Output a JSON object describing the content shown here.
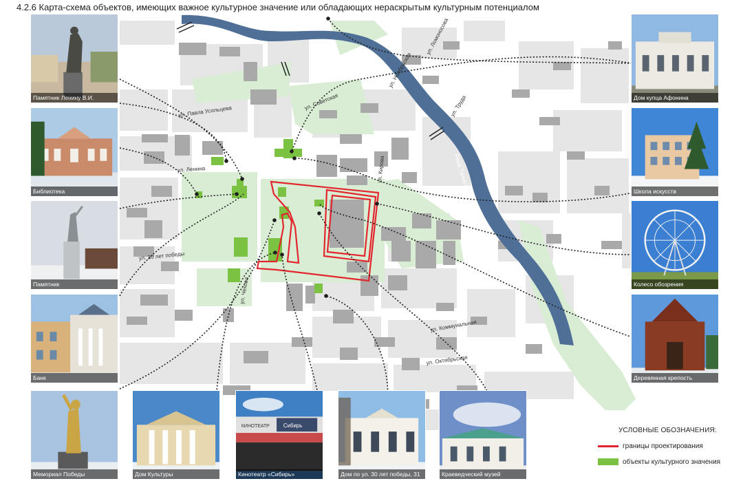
{
  "title": "4.2.6 Карта-схема объектов, имеющих важное культурное значение или обладающих нераскрытым культурным потенциалом",
  "colors": {
    "water": "#4f6f97",
    "park": "#d9ecd4",
    "culture": "#7cc242",
    "boundary": "#e3262d",
    "building": "#a9a9a9",
    "block": "#e6e6e6",
    "road": "#ffffff"
  },
  "streets": {
    "usoltseva": "ул. Павла Усольцева",
    "sovetskaya": "ул. Советская",
    "lenina": "ул. Ленина",
    "pobedy": "ул. 30 лет победы",
    "chekhova": "ул. Чехова",
    "lomonosova": "ул. Ломоносова",
    "noyabrskaya": "ул. Ноябрьская",
    "truda": "ул. Труда",
    "kirova": "ул. Кирова",
    "kommunalnaya": "ул. Коммунальная",
    "oktyabrskaya": "ул. Октябрьская",
    "river": "Река Тюкалка"
  },
  "photos": {
    "lenin": "Памятник Ленину В.И.",
    "library": "Библиотека",
    "monument": "Памятник",
    "bank": "Банк",
    "memorial": "Мемориал Победы",
    "culture_house": "Дом Культуры",
    "cinema": "Кинотеатр «Сибирь»",
    "house31": "Дом по ул. 30 лет победы, 31",
    "museum": "Краеведческий музей",
    "afonin": "Дом купца Афонина",
    "art_school": "Школа искусств",
    "wheel": "Колесо обозрения",
    "fortress": "Деревянная крепость"
  },
  "photo_signs": {
    "cinema_top": "КИНОТЕАТР",
    "cinema_name": "Сибирь"
  },
  "legend": {
    "title": "УСЛОВНЫЕ ОБОЗНАЧЕНИЯ:",
    "boundary": "границы проектирования",
    "culture": "объекты культурного значения"
  }
}
